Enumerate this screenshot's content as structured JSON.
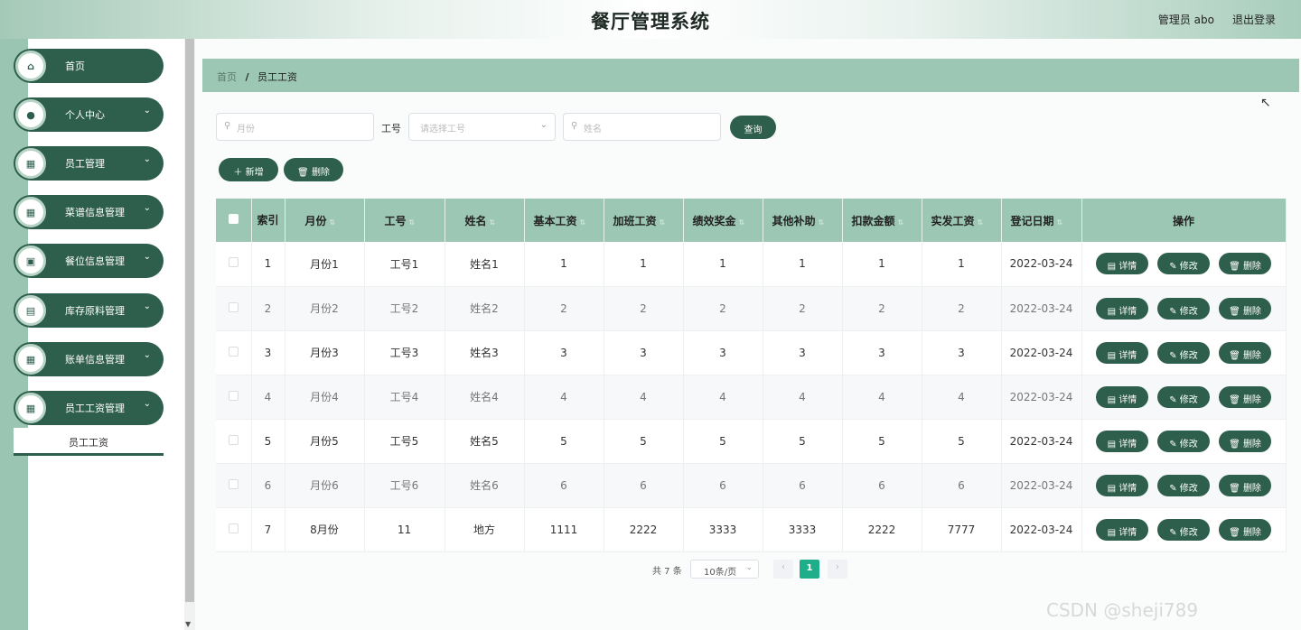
{
  "header": {
    "title": "餐厅管理系统",
    "admin": "管理员 abo",
    "logout": "退出登录"
  },
  "sidebar": {
    "items": [
      {
        "label": "首页",
        "icon": "home-icon",
        "glyph": "⌂",
        "chev": ""
      },
      {
        "label": "个人中心",
        "icon": "user-icon",
        "glyph": "●",
        "chev": "⌄"
      },
      {
        "label": "员工管理",
        "icon": "grid-icon",
        "glyph": "▦",
        "chev": "⌄"
      },
      {
        "label": "菜谱信息管理",
        "icon": "grid-icon",
        "glyph": "▦",
        "chev": "⌄"
      },
      {
        "label": "餐位信息管理",
        "icon": "clipboard-icon",
        "glyph": "▣",
        "chev": "⌄"
      },
      {
        "label": "库存原料管理",
        "icon": "document-icon",
        "glyph": "▤",
        "chev": "⌄"
      },
      {
        "label": "账单信息管理",
        "icon": "grid-icon",
        "glyph": "▦",
        "chev": "⌄"
      },
      {
        "label": "员工工资管理",
        "icon": "grid-icon",
        "glyph": "▦",
        "chev": "⌄"
      }
    ],
    "submenu": "员工工资"
  },
  "breadcrumb": {
    "home": "首页",
    "sep": "/",
    "current": "员工工资"
  },
  "search": {
    "month_placeholder": "月份",
    "emp_label": "工号",
    "emp_placeholder": "请选择工号",
    "name_placeholder": "姓名",
    "query": "查询"
  },
  "actions": {
    "add": "新增",
    "delete": "删除"
  },
  "table": {
    "headers": [
      "索引",
      "月份",
      "工号",
      "姓名",
      "基本工资",
      "加班工资",
      "绩效奖金",
      "其他补助",
      "扣款金额",
      "实发工资",
      "登记日期",
      "操作"
    ],
    "rows": [
      [
        "1",
        "月份1",
        "工号1",
        "姓名1",
        "1",
        "1",
        "1",
        "1",
        "1",
        "1",
        "2022-03-24"
      ],
      [
        "2",
        "月份2",
        "工号2",
        "姓名2",
        "2",
        "2",
        "2",
        "2",
        "2",
        "2",
        "2022-03-24"
      ],
      [
        "3",
        "月份3",
        "工号3",
        "姓名3",
        "3",
        "3",
        "3",
        "3",
        "3",
        "3",
        "2022-03-24"
      ],
      [
        "4",
        "月份4",
        "工号4",
        "姓名4",
        "4",
        "4",
        "4",
        "4",
        "4",
        "4",
        "2022-03-24"
      ],
      [
        "5",
        "月份5",
        "工号5",
        "姓名5",
        "5",
        "5",
        "5",
        "5",
        "5",
        "5",
        "2022-03-24"
      ],
      [
        "6",
        "月份6",
        "工号6",
        "姓名6",
        "6",
        "6",
        "6",
        "6",
        "6",
        "6",
        "2022-03-24"
      ],
      [
        "7",
        "8月份",
        "11",
        "地方",
        "1111",
        "2222",
        "3333",
        "3333",
        "2222",
        "7777",
        "2022-03-24"
      ]
    ],
    "row_actions": {
      "detail": "详情",
      "edit": "修改",
      "delete": "删除"
    }
  },
  "pagination": {
    "total": "共 7 条",
    "page_size": "10条/页",
    "current": "1",
    "prev": "‹",
    "next": "›"
  },
  "watermark": "CSDN @sheji789",
  "colors": {
    "primary": "#2e5e4c",
    "header_row": "#9cc7b4",
    "page_active": "#1fae8a"
  }
}
